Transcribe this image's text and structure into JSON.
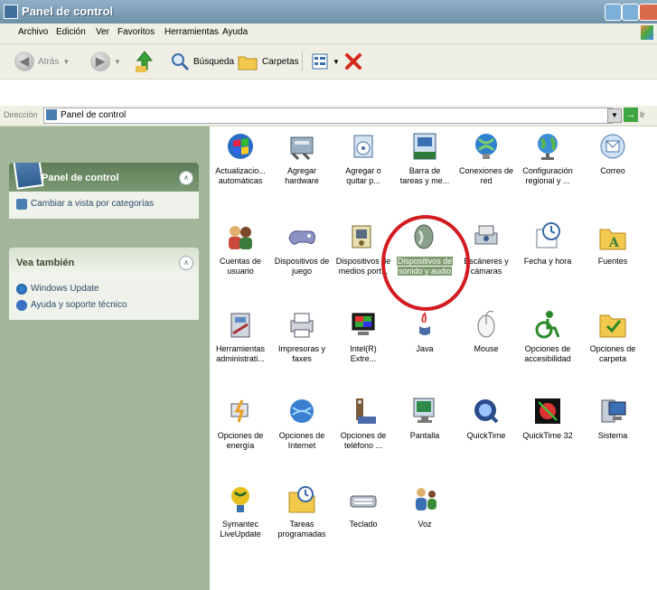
{
  "window": {
    "title": "Panel de control"
  },
  "menu": [
    "Archivo",
    "Edición",
    "Ver",
    "Favoritos",
    "Herramientas",
    "Ayuda"
  ],
  "toolbar": {
    "back": "Atrás",
    "search": "Búsqueda",
    "folders": "Carpetas"
  },
  "address": {
    "label": "Dirección",
    "value": "Panel de control",
    "go": "Ir"
  },
  "sidebar": {
    "panel_title": "Panel de control",
    "switch_view": "Cambiar a vista por categorías",
    "see_also_title": "Vea también",
    "see_also": [
      "Windows Update",
      "Ayuda y soporte técnico"
    ]
  },
  "items": [
    {
      "label": [
        "Actualizacio...",
        "automáticas"
      ],
      "icon": "windows-update-icon"
    },
    {
      "label": [
        "Agregar",
        "hardware"
      ],
      "icon": "add-hardware-icon"
    },
    {
      "label": [
        "Agregar o",
        "quitar p..."
      ],
      "icon": "add-remove-programs-icon"
    },
    {
      "label": [
        "Barra de",
        "tareas y me..."
      ],
      "icon": "taskbar-icon"
    },
    {
      "label": [
        "Conexiones de",
        "red"
      ],
      "icon": "network-connections-icon"
    },
    {
      "label": [
        "Configuración",
        "regional y ..."
      ],
      "icon": "regional-settings-icon"
    },
    {
      "label": [
        "Correo"
      ],
      "icon": "mail-icon"
    },
    {
      "label": [
        "Cuentas de",
        "usuario"
      ],
      "icon": "user-accounts-icon"
    },
    {
      "label": [
        "Dispositivos de",
        "juego"
      ],
      "icon": "game-controllers-icon"
    },
    {
      "label": [
        "Dispositivos de",
        "medios port..."
      ],
      "icon": "portable-media-icon"
    },
    {
      "label": [
        "Dispositivos de",
        "sonido y audio"
      ],
      "icon": "sound-audio-icon",
      "selected": true
    },
    {
      "label": [
        "Escáneres y",
        "cámaras"
      ],
      "icon": "scanners-cameras-icon"
    },
    {
      "label": [
        "Fecha y hora"
      ],
      "icon": "date-time-icon"
    },
    {
      "label": [
        "Fuentes"
      ],
      "icon": "fonts-icon"
    },
    {
      "label": [
        "Herramientas",
        "administrati..."
      ],
      "icon": "admin-tools-icon"
    },
    {
      "label": [
        "Impresoras y",
        "faxes"
      ],
      "icon": "printers-icon"
    },
    {
      "label": [
        "Intel(R)",
        "Extre..."
      ],
      "icon": "intel-graphics-icon"
    },
    {
      "label": [
        "Java"
      ],
      "icon": "java-icon"
    },
    {
      "label": [
        "Mouse"
      ],
      "icon": "mouse-icon"
    },
    {
      "label": [
        "Opciones de",
        "accesibilidad"
      ],
      "icon": "accessibility-icon"
    },
    {
      "label": [
        "Opciones de",
        "carpeta"
      ],
      "icon": "folder-options-icon"
    },
    {
      "label": [
        "Opciones de",
        "energía"
      ],
      "icon": "power-options-icon"
    },
    {
      "label": [
        "Opciones de",
        "Internet"
      ],
      "icon": "internet-options-icon"
    },
    {
      "label": [
        "Opciones de",
        "teléfono ..."
      ],
      "icon": "phone-modem-icon"
    },
    {
      "label": [
        "Pantalla"
      ],
      "icon": "display-icon"
    },
    {
      "label": [
        "QuickTime"
      ],
      "icon": "quicktime-icon"
    },
    {
      "label": [
        "QuickTime 32"
      ],
      "icon": "quicktime32-icon"
    },
    {
      "label": [
        "Sistema"
      ],
      "icon": "system-icon"
    },
    {
      "label": [
        "Symantec",
        "LiveUpdate"
      ],
      "icon": "symantec-liveupdate-icon"
    },
    {
      "label": [
        "Tareas",
        "programadas"
      ],
      "icon": "scheduled-tasks-icon"
    },
    {
      "label": [
        "Teclado"
      ],
      "icon": "keyboard-icon"
    },
    {
      "label": [
        "Voz"
      ],
      "icon": "speech-icon"
    }
  ]
}
